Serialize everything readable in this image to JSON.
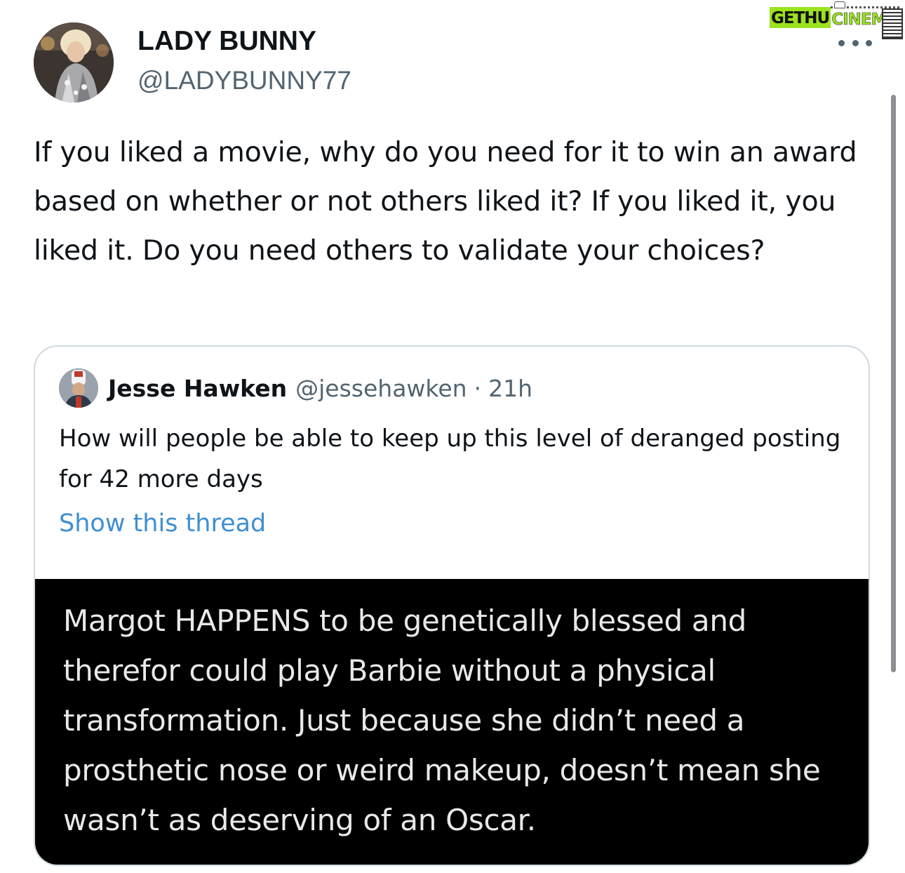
{
  "watermark": {
    "part1": "GETHU",
    "part2": "CINEMA"
  },
  "tweet": {
    "author_name": "LADY BUNNY",
    "author_handle": "@LADYBUNNY77",
    "text": "If you liked a movie, why do you need for it to win an award based on whether or not others liked it? If you liked it, you liked it. Do you need others to validate your choices?"
  },
  "quoted": {
    "author_name": "Jesse Hawken",
    "author_handle": "@jessehawken",
    "separator": "·",
    "time": "21h",
    "text": "How will people be able to keep up this level of deranged posting for 42 more days",
    "show_thread": "Show this thread",
    "image_text": "Margot HAPPENS to be genetically blessed and therefor could play Barbie without a physical transformation. Just because she didn’t need a prosthetic nose or weird makeup, doesn’t mean she wasn’t as deserving of an Oscar."
  },
  "icons": {
    "more": "more-horizontal-icon"
  },
  "colors": {
    "text_primary": "#0f1419",
    "text_secondary": "#536471",
    "link": "#3f8fd2",
    "border": "#cfd9de",
    "watermark_green": "#9be21f"
  }
}
